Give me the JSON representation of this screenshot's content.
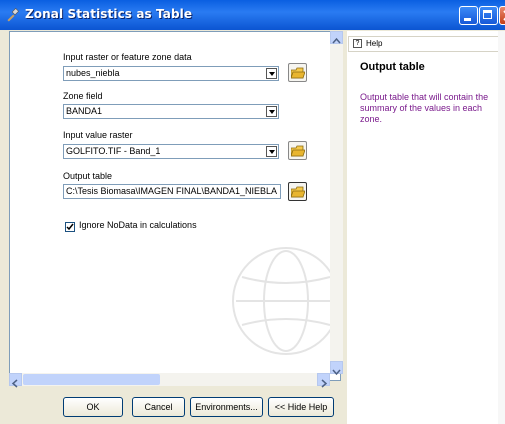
{
  "window": {
    "title": "Zonal Statistics as Table"
  },
  "form": {
    "zone_data": {
      "label": "Input raster or feature zone data",
      "value": "nubes_niebla"
    },
    "zone_field": {
      "label": "Zone field",
      "value": "BANDA1"
    },
    "value_raster": {
      "label": "Input value raster",
      "value": "GOLFITO.TIF - Band_1"
    },
    "output_table": {
      "label": "Output table",
      "value": "C:\\Tesis Biomasa\\IMAGEN FINAL\\BANDA1_NIEBLA"
    },
    "ignore_nodata": {
      "label": "Ignore NoData in calculations",
      "checked": true
    }
  },
  "buttons": {
    "ok": "OK",
    "cancel": "Cancel",
    "environments": "Environments...",
    "hide_help": "<< Hide Help"
  },
  "help": {
    "tab": "Help",
    "title": "Output table",
    "body": "Output table that will contain the summary of the values in each zone."
  }
}
